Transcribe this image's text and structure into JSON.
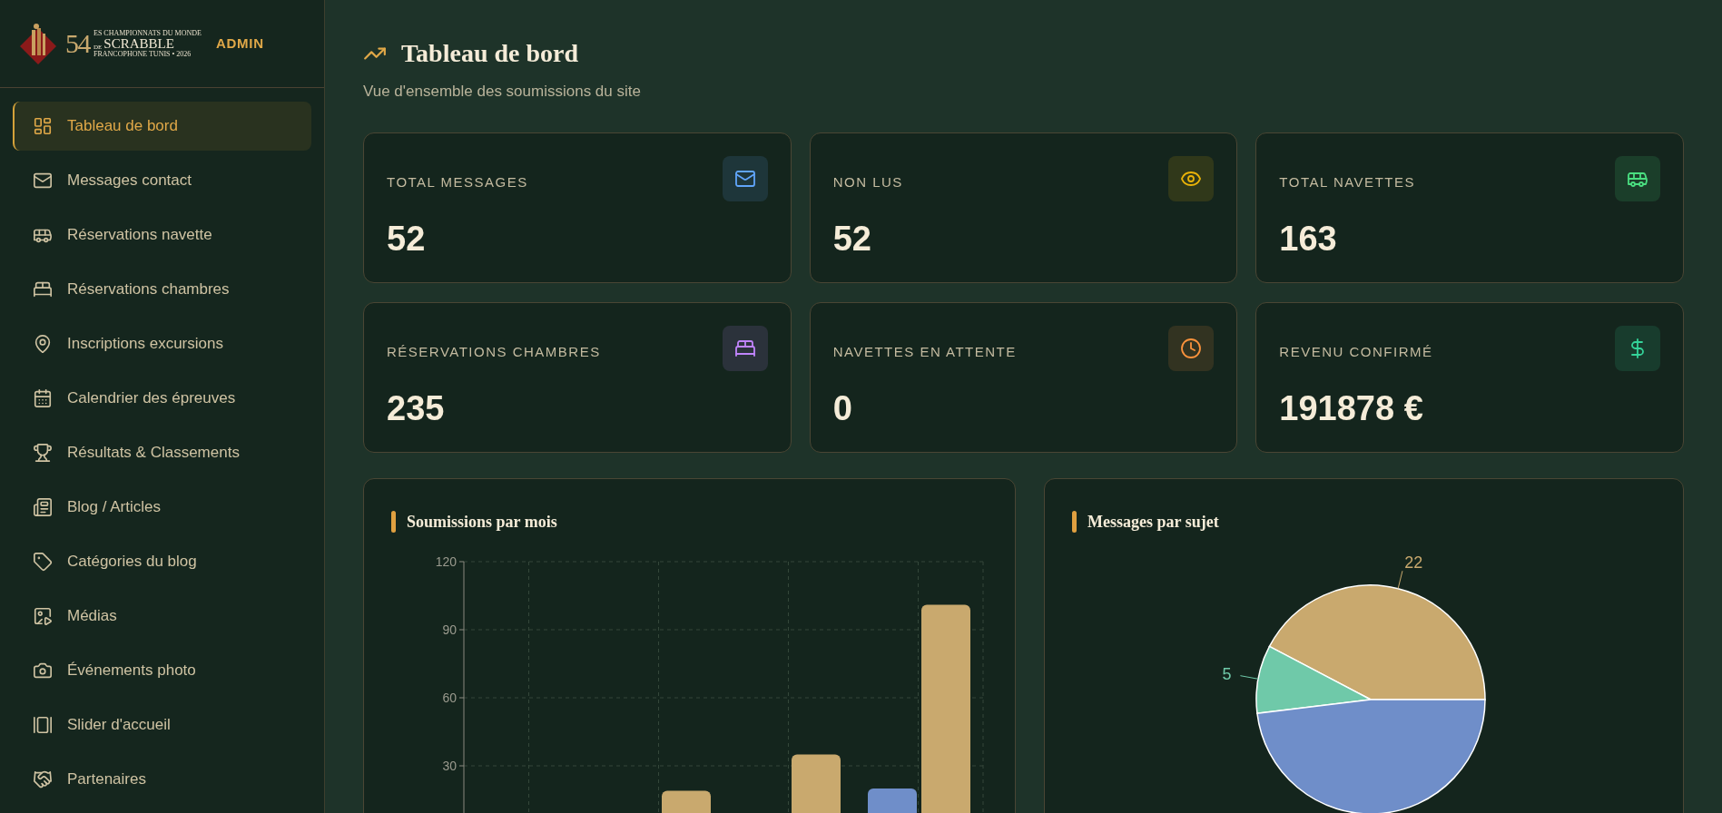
{
  "sidebar": {
    "logo": {
      "number": "54",
      "line1": "ES CHAMPIONNATS DU MONDE",
      "line2_prefix": "DE",
      "line2": "SCRABBLE",
      "line3": "FRANCOPHONE TUNIS • 2026"
    },
    "badge": "ADMIN",
    "items": [
      {
        "label": "Tableau de bord",
        "selected": true
      },
      {
        "label": "Messages contact",
        "selected": false
      },
      {
        "label": "Réservations navette",
        "selected": false
      },
      {
        "label": "Réservations chambres",
        "selected": false
      },
      {
        "label": "Inscriptions excursions",
        "selected": false
      },
      {
        "label": "Calendrier des épreuves",
        "selected": false
      },
      {
        "label": "Résultats & Classements",
        "selected": false
      },
      {
        "label": "Blog / Articles",
        "selected": false
      },
      {
        "label": "Catégories du blog",
        "selected": false
      },
      {
        "label": "Médias",
        "selected": false
      },
      {
        "label": "Événements photo",
        "selected": false
      },
      {
        "label": "Slider d'accueil",
        "selected": false
      },
      {
        "label": "Partenaires",
        "selected": false
      }
    ]
  },
  "header": {
    "title": "Tableau de bord",
    "subtitle": "Vue d'ensemble des soumissions du site"
  },
  "stats": [
    {
      "label": "TOTAL MESSAGES",
      "value": "52",
      "color": "#60a5fa"
    },
    {
      "label": "NON LUS",
      "value": "52",
      "color": "#eab308"
    },
    {
      "label": "TOTAL NAVETTES",
      "value": "163",
      "color": "#4ade80"
    },
    {
      "label": "RÉSERVATIONS CHAMBRES",
      "value": "235",
      "color": "#c084fc"
    },
    {
      "label": "NAVETTES EN ATTENTE",
      "value": "0",
      "color": "#fb923c"
    },
    {
      "label": "REVENU CONFIRMÉ",
      "value": "191878 €",
      "color": "#34d399"
    }
  ],
  "charts": [
    {
      "title": "Soumissions par mois",
      "chart_data": {
        "type": "bar",
        "grid": true,
        "ylim": [
          0,
          120
        ],
        "yticks": [
          30,
          60,
          90,
          120
        ],
        "series": [
          {
            "color": "#6f8ec9",
            "values": [
              null,
              null,
              null,
              20
            ]
          },
          {
            "color": "#c9a96e",
            "values": [
              null,
              19,
              35,
              101
            ]
          }
        ]
      }
    },
    {
      "title": "Messages par sujet",
      "chart_data": {
        "type": "pie",
        "values": [
          22,
          5,
          25
        ],
        "colors": [
          "#c9a96e",
          "#6fc9a9",
          "#6f8ec9"
        ],
        "value_labels": [
          "22",
          "5",
          null
        ]
      }
    }
  ]
}
